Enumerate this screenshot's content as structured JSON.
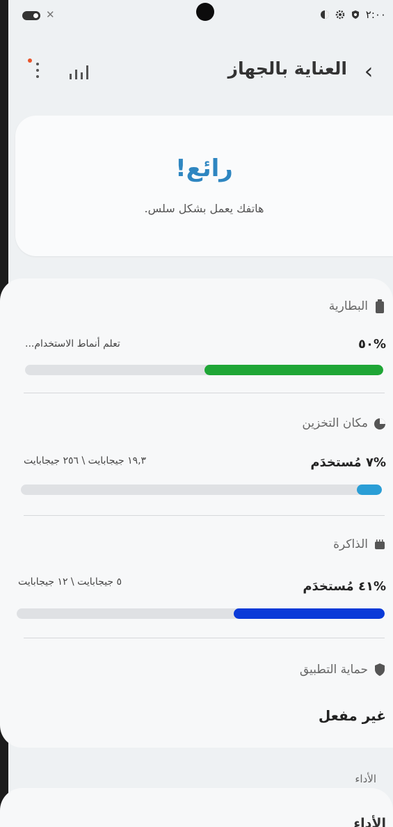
{
  "status_bar": {
    "time": "٢:٠٠"
  },
  "header": {
    "title": "العناية بالجهاز"
  },
  "status": {
    "headline": "رائع!",
    "message": "هاتفك يعمل بشكل سلس."
  },
  "battery": {
    "title": "البطارية",
    "value": "%٥٠",
    "detail": "تعلم أنماط الاستخدام...",
    "percent": 50,
    "color": "#1fa636"
  },
  "storage": {
    "title": "مكان التخزين",
    "value": "%٧ مُستخدَم",
    "detail": "١٩,٣ جيجابايت \\ ٢٥٦ جيجابايت",
    "percent": 7,
    "color": "#2a9ed6"
  },
  "memory": {
    "title": "الذاكرة",
    "value": "%٤١ مُستخدَم",
    "detail": "٥ جيجابايت \\ ١٢ جيجابايت",
    "percent": 41,
    "color": "#0a3ad8"
  },
  "app_protection": {
    "title": "حماية التطبيق",
    "value": "غير مفعل"
  },
  "performance": {
    "title": "الأداء",
    "peek": "الأداء"
  }
}
